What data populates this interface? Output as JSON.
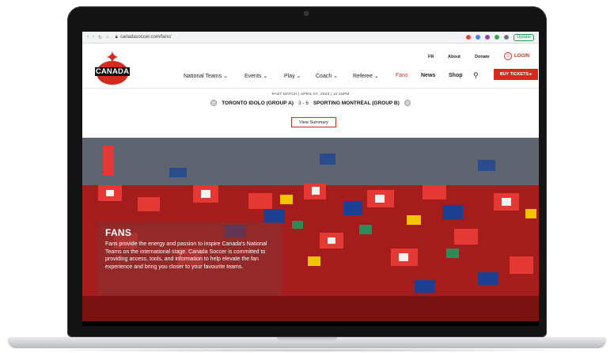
{
  "browser": {
    "url": "canadasoccer.com/fans/",
    "update_label": "Update"
  },
  "site": {
    "logo_text": "CANADA",
    "utility": {
      "fr": "FR",
      "about": "About",
      "donate": "Donate",
      "login": "LOGIN"
    },
    "nav": [
      {
        "label": "National Teams ⌄"
      },
      {
        "label": "Events ⌄"
      },
      {
        "label": "Play ⌄"
      },
      {
        "label": "Coach ⌄"
      },
      {
        "label": "Referee ⌄"
      },
      {
        "label": "Fans"
      },
      {
        "label": "News"
      },
      {
        "label": "Shop"
      }
    ],
    "buy_tickets": "BUY TICKETS ▸"
  },
  "match": {
    "past_match": "PAST MATCH | APRIL 07, 2023 | 12:15PM",
    "home": "TORONTO IDOLO (GROUP A)",
    "score": "3 - 6",
    "away": "SPORTING MONTRÉAL (GROUP B)",
    "summary_label": "View Summary"
  },
  "hero": {
    "title": "FANS",
    "body": "Fans provide the energy and passion to inspire Canada's National Teams on the international stage. Canada Soccer is committed to providing access, tools, and information to help elevate the fan experience and bring you closer to your favourite teams."
  },
  "colors": {
    "brand_red": "#d52b1e",
    "update_green": "#2e9b4f"
  }
}
